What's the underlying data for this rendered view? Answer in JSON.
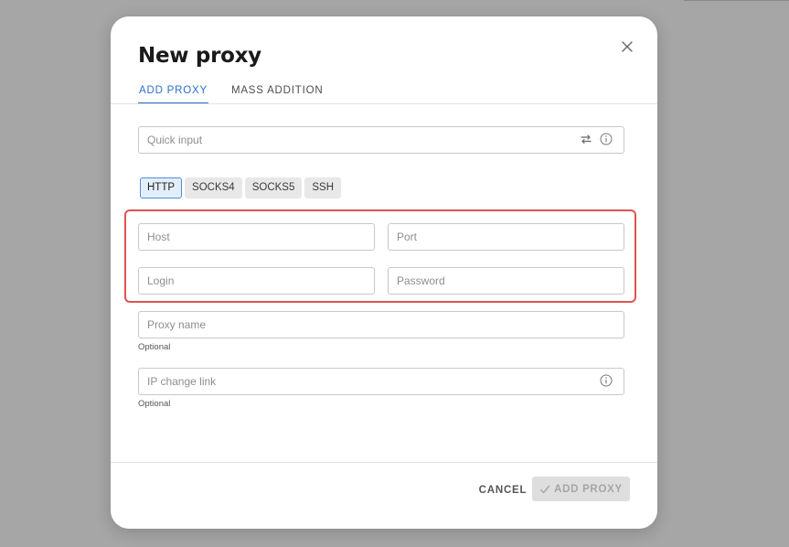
{
  "modal": {
    "title": "New proxy",
    "close_icon": "close-icon"
  },
  "tabs": [
    {
      "label": "ADD PROXY",
      "active": true
    },
    {
      "label": "MASS ADDITION",
      "active": false
    }
  ],
  "quick_input": {
    "placeholder": "Quick input",
    "value": "",
    "icons": [
      "swap-arrows-icon",
      "info-icon"
    ]
  },
  "protocols": [
    {
      "label": "HTTP",
      "selected": true
    },
    {
      "label": "SOCKS4",
      "selected": false
    },
    {
      "label": "SOCKS5",
      "selected": false
    },
    {
      "label": "SSH",
      "selected": false
    }
  ],
  "fields": {
    "host": {
      "placeholder": "Host",
      "value": ""
    },
    "port": {
      "placeholder": "Port",
      "value": ""
    },
    "login": {
      "placeholder": "Login",
      "value": ""
    },
    "password": {
      "placeholder": "Password",
      "value": ""
    },
    "proxy_name": {
      "placeholder": "Proxy name",
      "value": "",
      "helper": "Optional"
    },
    "ip_change_link": {
      "placeholder": "IP change link",
      "value": "",
      "helper": "Optional",
      "icon": "info-icon"
    }
  },
  "footer": {
    "cancel_label": "CANCEL",
    "add_label": "ADD PROXY",
    "add_icon": "check-icon",
    "add_disabled": true
  },
  "colors": {
    "accent": "#2d6fc9",
    "highlight": "#e05252",
    "overlay": "#a6a6a6",
    "disabled_button": "#dedede"
  }
}
